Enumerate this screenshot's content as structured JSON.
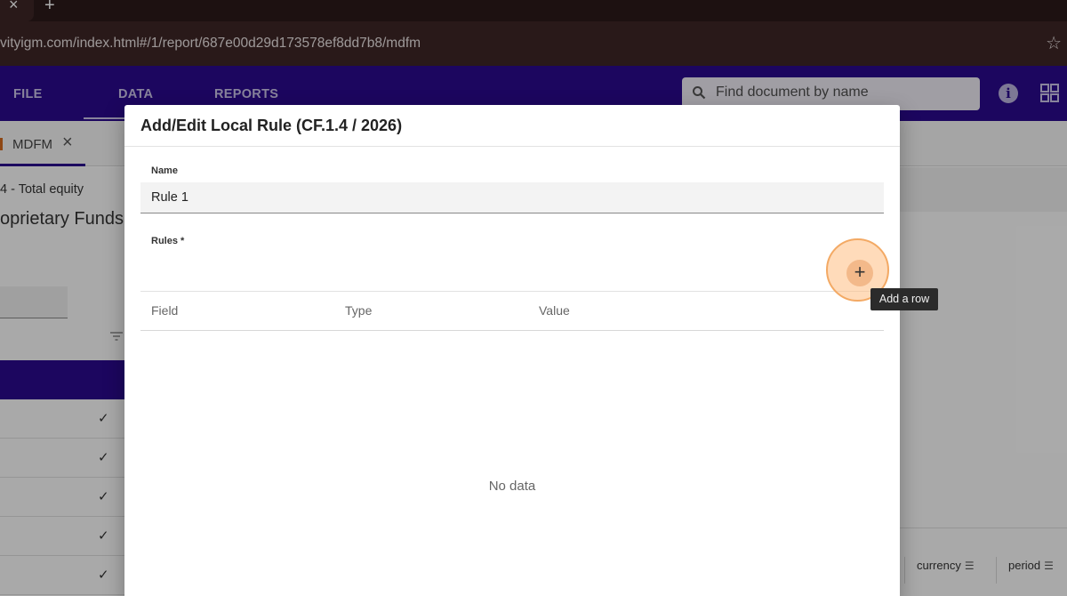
{
  "browser": {
    "url": "vityigm.com/index.html#/1/report/687e00d29d173578ef8dd7b8/mdfm",
    "tab_close": "×",
    "new_tab": "+",
    "bookmark": "☆"
  },
  "app": {
    "menu": [
      "FILE",
      "DATA",
      "REPORTS"
    ],
    "search_placeholder": "Find document by name",
    "info": "i"
  },
  "background": {
    "doc_tab": "MDFM",
    "doc_tab_close": "×",
    "equity_label": "4 - Total equity",
    "funds_title": "oprietary Funds",
    "check": "✓",
    "columns": [
      "currency",
      "period"
    ]
  },
  "dialog": {
    "title": "Add/Edit Local Rule (CF.1.4 / 2026)",
    "name_label": "Name",
    "name_value": "Rule 1",
    "rules_label": "Rules *",
    "columns": [
      "Field",
      "Type",
      "Value"
    ],
    "empty_text": "No data",
    "add_button": "+",
    "add_tooltip": "Add a row"
  },
  "colors": {
    "appbar": "#2a0a8c",
    "chrome": "#3d2626",
    "highlight": "#f3a964"
  }
}
